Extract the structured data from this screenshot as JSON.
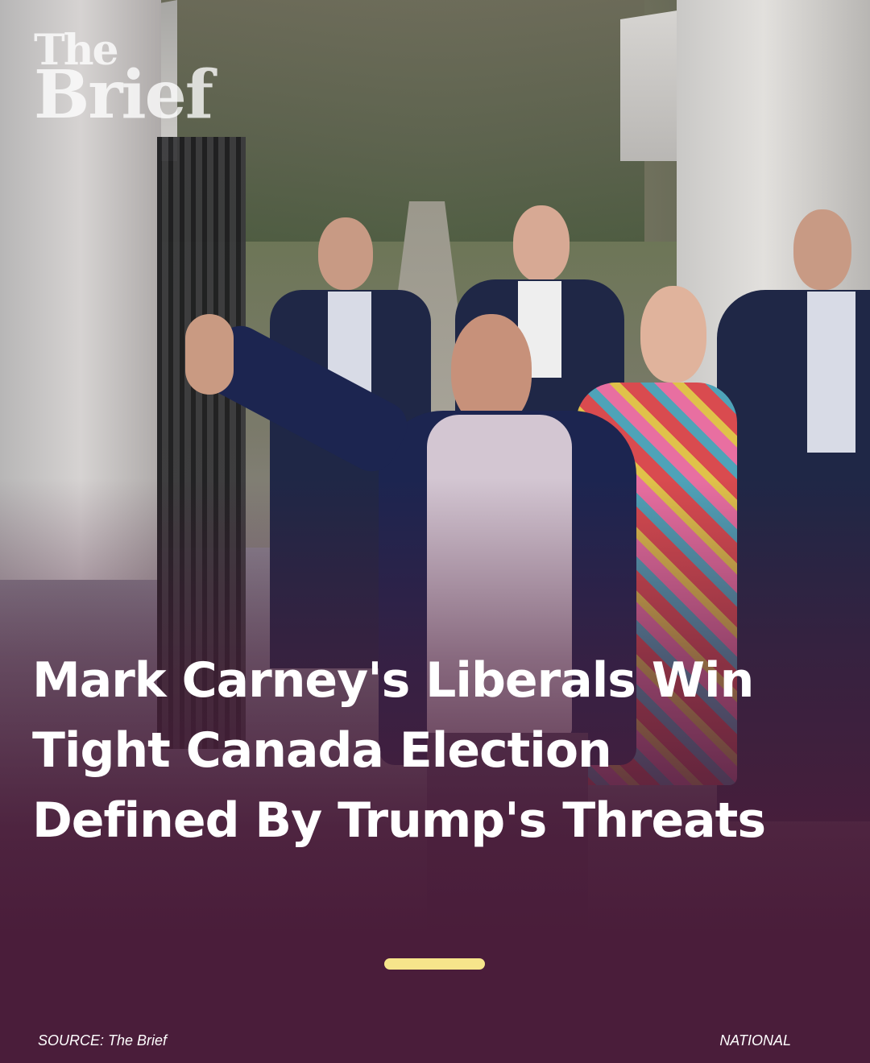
{
  "logo": {
    "line1": "The",
    "line2": "Brief"
  },
  "headline": {
    "line1": "Mark Carney's Liberals Win",
    "line2": "Tight Canada Election",
    "line3": "Defined By Trump's Threats"
  },
  "footer": {
    "source": "SOURCE: The Brief",
    "category": "NATIONAL"
  },
  "colors": {
    "overlay": "#4a1d3a",
    "accent": "#f6e58b",
    "text": "#ffffff"
  }
}
